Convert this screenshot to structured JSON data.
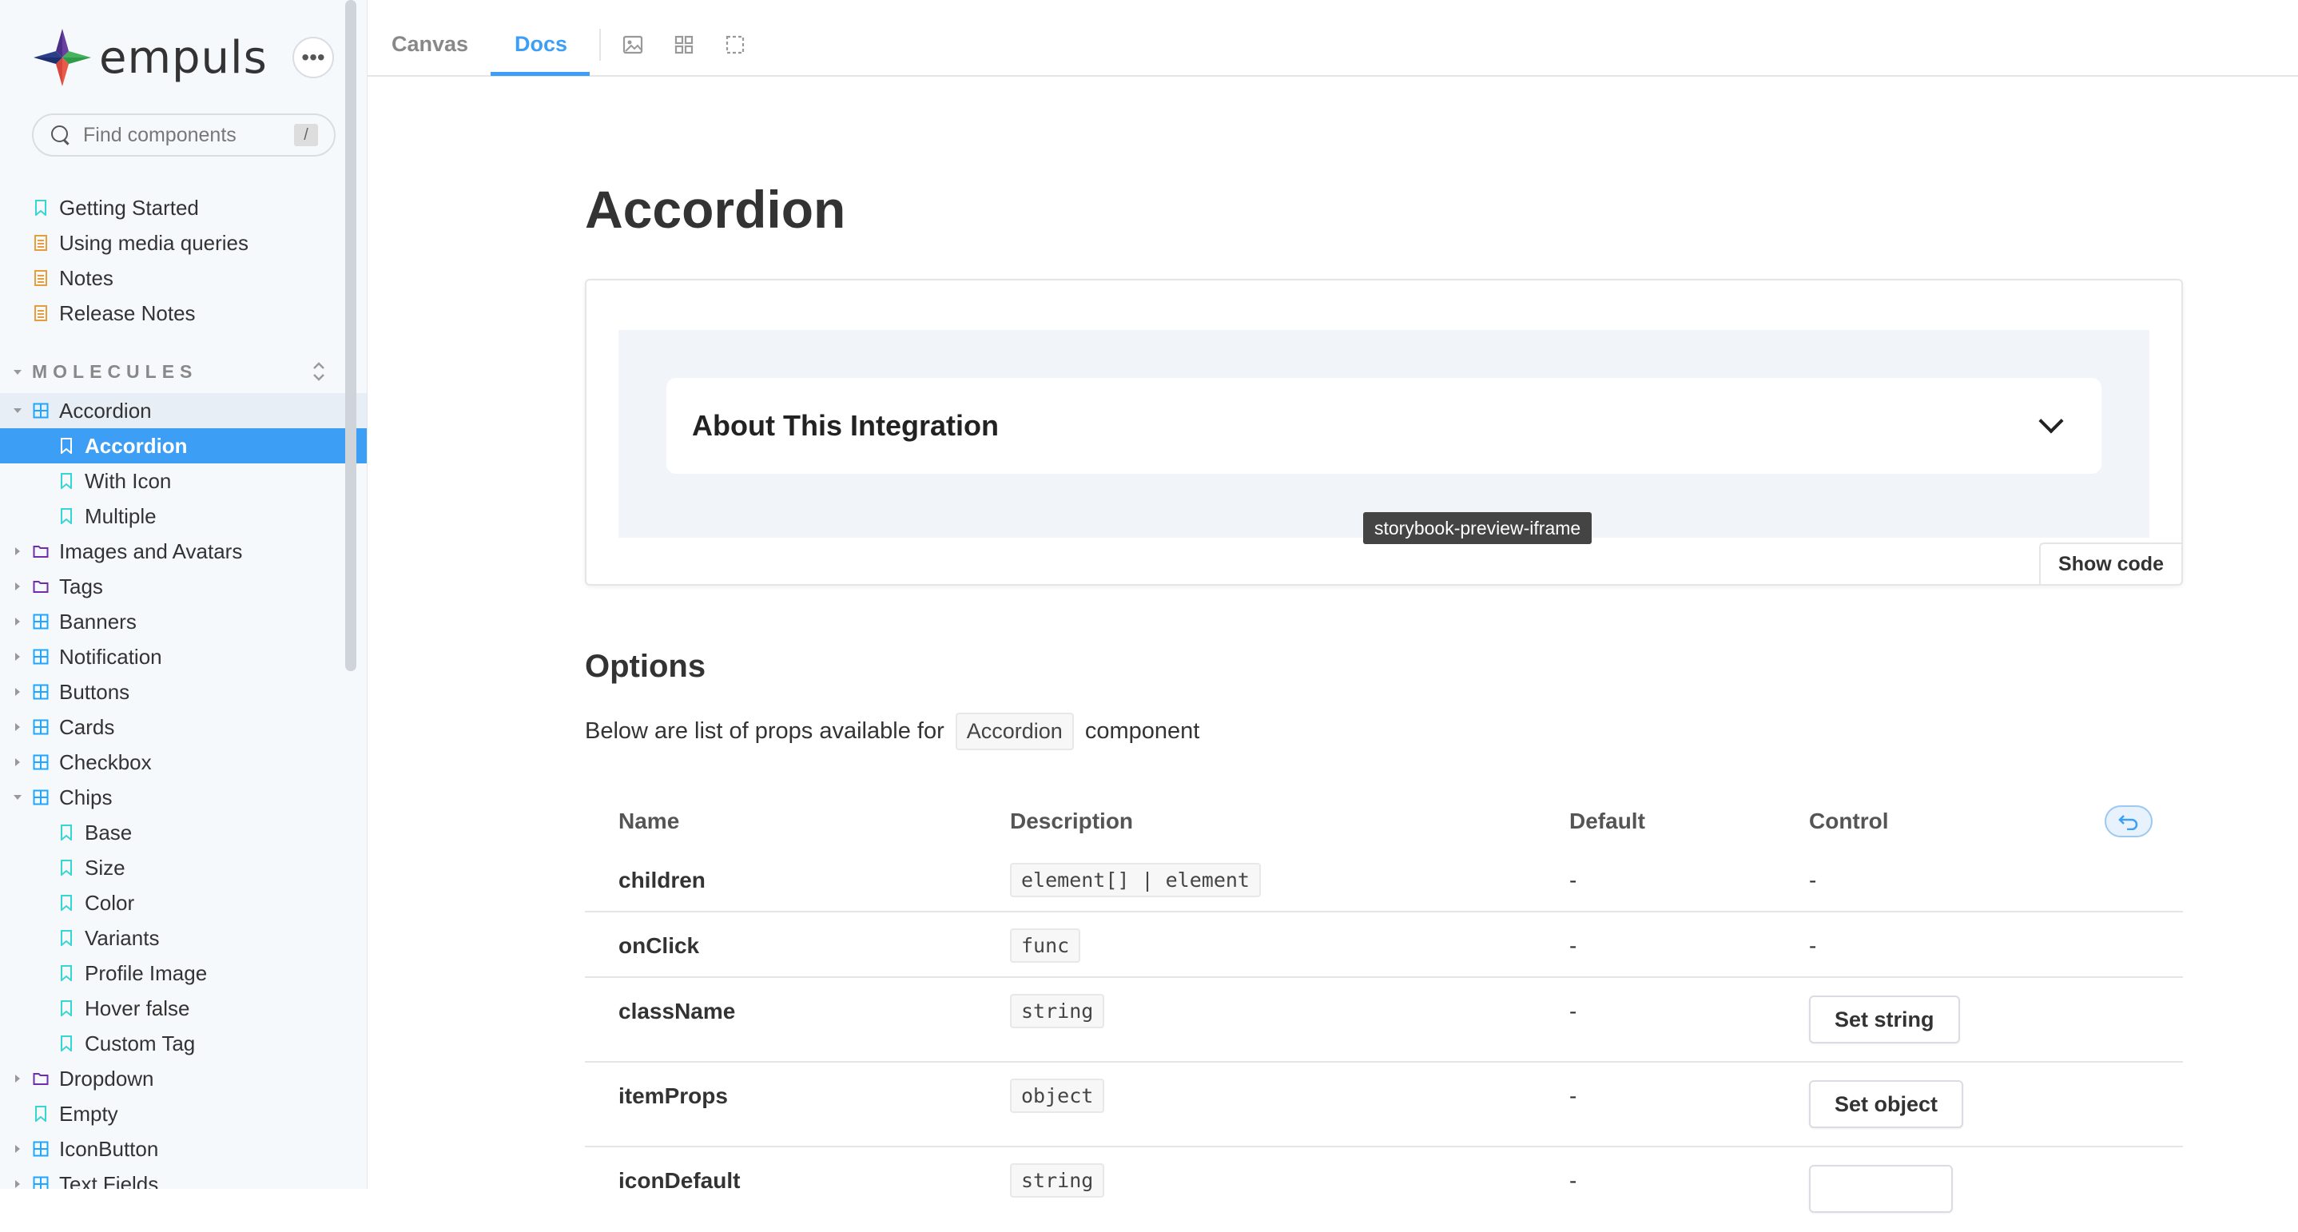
{
  "sidebar": {
    "logo_text": "empuls",
    "menu_label": "•••",
    "search_placeholder": "Find components",
    "search_shortcut": "/",
    "top_items": [
      {
        "label": "Getting Started",
        "icon": "bookmark-icon"
      },
      {
        "label": "Using media queries",
        "icon": "document-icon"
      },
      {
        "label": "Notes",
        "icon": "document-icon"
      },
      {
        "label": "Release Notes",
        "icon": "document-icon"
      }
    ],
    "section_title": "MOLECULES",
    "tree": [
      {
        "label": "Accordion",
        "icon": "component-icon"
      },
      {
        "label": "Accordion",
        "icon": "bookmark-icon"
      },
      {
        "label": "With Icon",
        "icon": "bookmark-icon"
      },
      {
        "label": "Multiple",
        "icon": "bookmark-icon"
      },
      {
        "label": "Images and Avatars",
        "icon": "folder-icon"
      },
      {
        "label": "Tags",
        "icon": "folder-icon"
      },
      {
        "label": "Banners",
        "icon": "component-icon"
      },
      {
        "label": "Notification",
        "icon": "component-icon"
      },
      {
        "label": "Buttons",
        "icon": "component-icon"
      },
      {
        "label": "Cards",
        "icon": "component-icon"
      },
      {
        "label": "Checkbox",
        "icon": "component-icon"
      },
      {
        "label": "Chips",
        "icon": "component-icon"
      },
      {
        "label": "Base",
        "icon": "bookmark-icon"
      },
      {
        "label": "Size",
        "icon": "bookmark-icon"
      },
      {
        "label": "Color",
        "icon": "bookmark-icon"
      },
      {
        "label": "Variants",
        "icon": "bookmark-icon"
      },
      {
        "label": "Profile Image",
        "icon": "bookmark-icon"
      },
      {
        "label": "Hover false",
        "icon": "bookmark-icon"
      },
      {
        "label": "Custom Tag",
        "icon": "bookmark-icon"
      },
      {
        "label": "Dropdown",
        "icon": "folder-icon"
      },
      {
        "label": "Empty",
        "icon": "bookmark-icon"
      },
      {
        "label": "IconButton",
        "icon": "component-icon"
      },
      {
        "label": "Text Fields",
        "icon": "component-icon"
      }
    ]
  },
  "toolbar": {
    "tabs": [
      {
        "label": "Canvas"
      },
      {
        "label": "Docs"
      }
    ],
    "active_tab": "Docs"
  },
  "main": {
    "title": "Accordion",
    "preview": {
      "accordion_title": "About This Integration",
      "tooltip": "storybook-preview-iframe",
      "show_code_label": "Show code"
    },
    "options_heading": "Options",
    "options_desc_before": "Below are list of props available for",
    "options_desc_code": "Accordion",
    "options_desc_after": "component",
    "table": {
      "headers": [
        "Name",
        "Description",
        "Default",
        "Control"
      ],
      "rows": [
        {
          "name": "children",
          "type": "element[] | element",
          "default": "-",
          "control": "-"
        },
        {
          "name": "onClick",
          "type": "func",
          "default": "-",
          "control": "-"
        },
        {
          "name": "className",
          "type": "string",
          "default": "-",
          "control": "Set string"
        },
        {
          "name": "itemProps",
          "type": "object",
          "default": "-",
          "control": "Set object"
        },
        {
          "name": "iconDefault",
          "type": "string",
          "default": "-",
          "control": ""
        }
      ]
    }
  },
  "colors": {
    "accent": "#3d9ef5",
    "bookmark_icon": "#37d5d3",
    "document_icon": "#e69d3a",
    "component_icon": "#1ea7fd",
    "folder_icon": "#6f2cac"
  }
}
